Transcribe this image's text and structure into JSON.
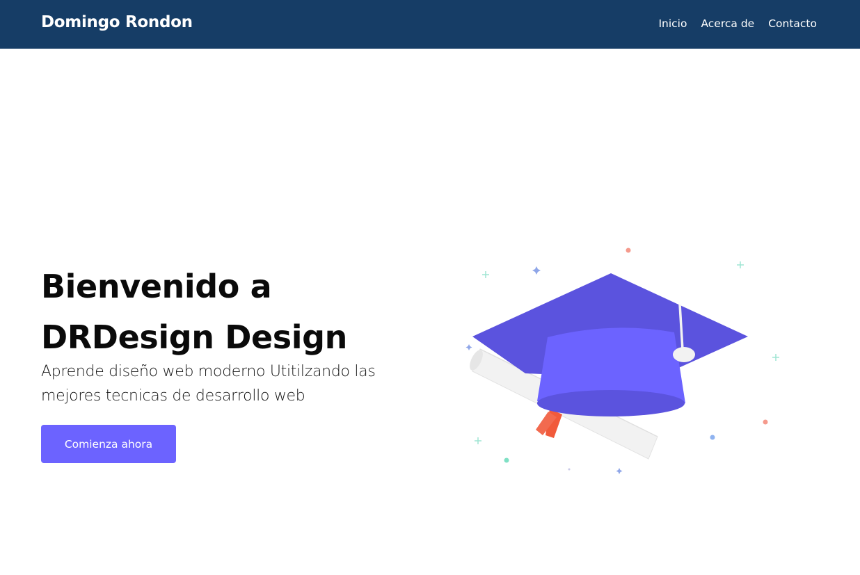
{
  "header": {
    "brand": "Domingo Rondon",
    "nav": [
      {
        "label": "Inicio"
      },
      {
        "label": "Acerca de"
      },
      {
        "label": "Contacto"
      }
    ]
  },
  "hero": {
    "title_line1": "Bienvenido a",
    "title_line2": "DRDesign Design",
    "subtitle": "Aprende diseño web moderno Utitilzando las mejores tecnicas de desarrollo web",
    "cta_label": "Comienza ahora"
  },
  "illustration": {
    "icon": "graduation-cap-icon",
    "colors": {
      "cap_top": "#5b53de",
      "cap_body": "#6c63ff",
      "diploma": "#f2f2f2",
      "ribbon": "#f15a3b",
      "tassel_button": "#f2f2f2"
    }
  },
  "theme": {
    "navbar_bg": "#163d66",
    "accent": "#6c63ff"
  }
}
